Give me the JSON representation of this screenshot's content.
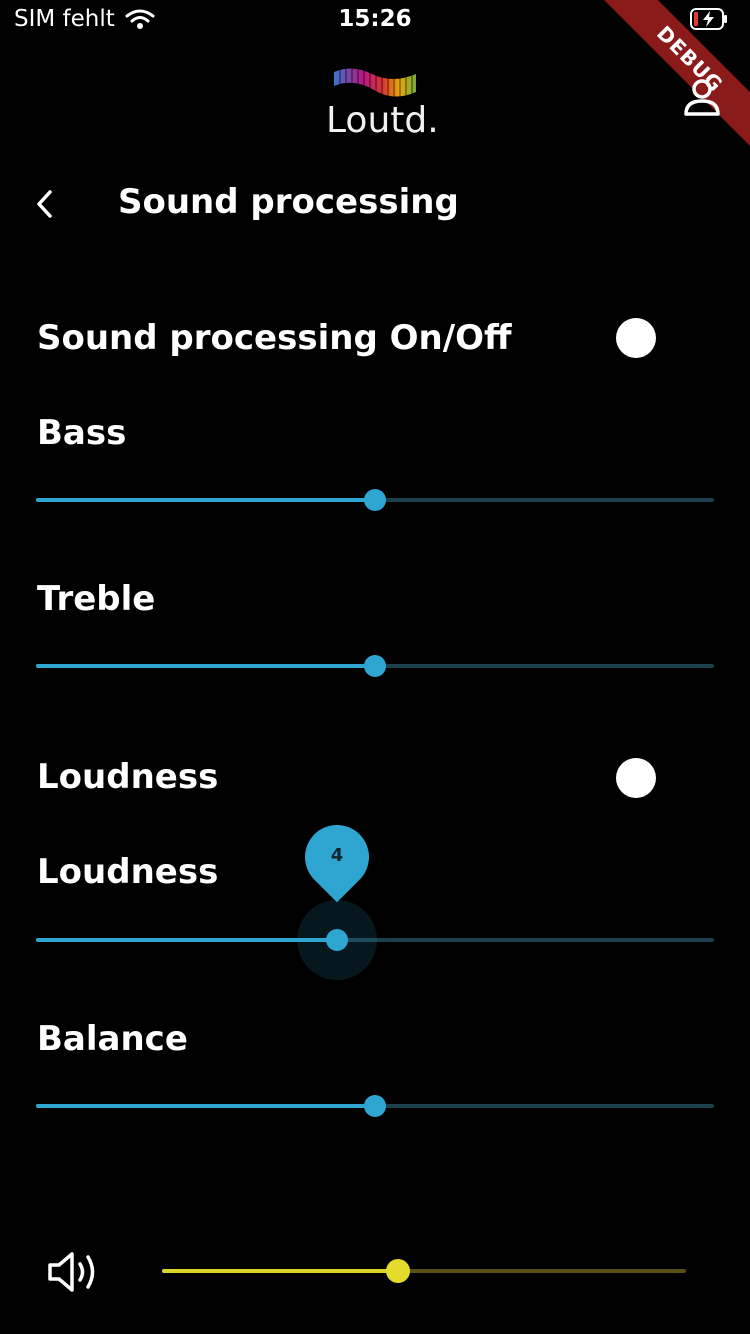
{
  "status": {
    "carrier": "SIM fehlt",
    "time": "15:26",
    "debug": "DEBUG"
  },
  "header": {
    "logo_text": "Loutd.",
    "title": "Sound processing"
  },
  "settings": {
    "processing_toggle_label": "Sound processing On/Off",
    "bass_label": "Bass",
    "bass_value": 0.5,
    "treble_label": "Treble",
    "treble_value": 0.5,
    "loudness_toggle_label": "Loudness",
    "loudness_label": "Loudness",
    "loudness_value": 0.444,
    "loudness_bubble": "4",
    "balance_label": "Balance",
    "balance_value": 0.5
  },
  "volume": {
    "value": 0.45
  },
  "colors": {
    "accent": "#2fa6d2",
    "volume_accent": "#e3dc2d",
    "background": "#000000"
  }
}
